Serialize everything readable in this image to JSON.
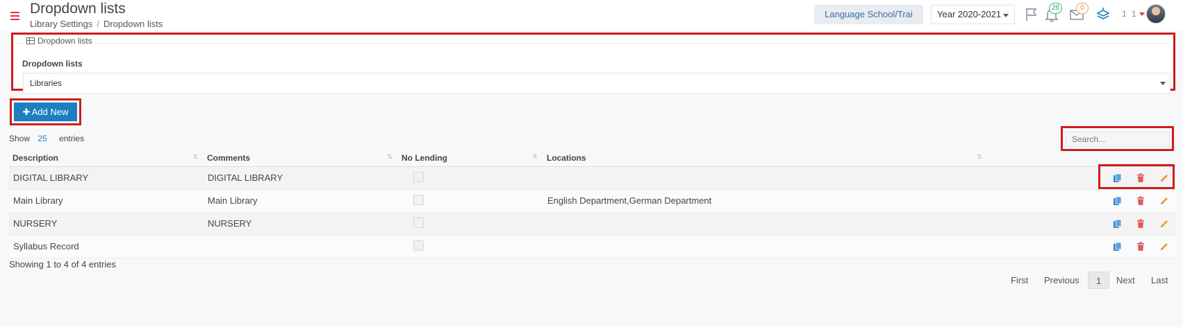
{
  "header": {
    "title": "Dropdown lists",
    "breadcrumb": [
      "Library Settings",
      "Dropdown lists"
    ],
    "school_button": "Language School/Trai",
    "year_select": "Year 2020-2021",
    "notification_count": "26",
    "message_count": "0",
    "user_label": "1 1"
  },
  "panel": {
    "legend": "Dropdown lists",
    "label": "Dropdown lists",
    "selected": "Libraries"
  },
  "toolbar": {
    "add_label": "Add New",
    "show_label": "Show",
    "entries_count": "25",
    "entries_label": "entries",
    "search_placeholder": "Search..."
  },
  "table": {
    "columns": [
      "Description",
      "Comments",
      "No Lending",
      "Locations"
    ],
    "rows": [
      {
        "description": "DIGITAL LIBRARY",
        "comments": "DIGITAL LIBRARY",
        "locations": ""
      },
      {
        "description": "Main Library",
        "comments": "Main Library",
        "locations": "English Department,German Department"
      },
      {
        "description": "NURSERY",
        "comments": "NURSERY",
        "locations": ""
      },
      {
        "description": "Syllabus Record",
        "comments": "",
        "locations": ""
      }
    ]
  },
  "footer": {
    "showing": "Showing 1 to 4 of 4 entries",
    "first": "First",
    "previous": "Previous",
    "page": "1",
    "next": "Next",
    "last": "Last"
  },
  "colors": {
    "primary": "#1c7fc1",
    "highlight": "#d11a1a",
    "copy_icon": "#2f7fc0",
    "delete_icon": "#e05a5a",
    "edit_icon": "#f0a030"
  }
}
